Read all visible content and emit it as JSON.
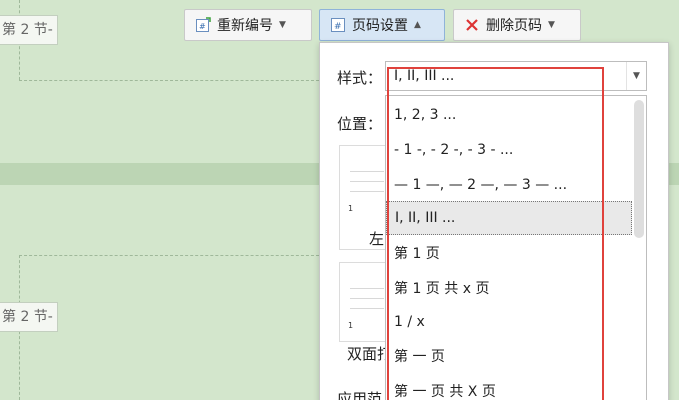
{
  "section_tag": "第 2 节-",
  "toolbar": {
    "renumber": "重新编号",
    "page_settings": "页码设置",
    "delete": "删除页码"
  },
  "panel": {
    "style_label": "样式：",
    "position_label": "位置：",
    "apply_label": "应用范",
    "selected_style": "I, II, III ...",
    "thumb_left_caption": "左",
    "thumb_double_caption": "双面打",
    "thumb_page_number": "1"
  },
  "dropdown": {
    "items": [
      "1, 2, 3 ...",
      "- 1 -, - 2 -, - 3 - ...",
      "— 1 —, — 2 —, — 3 — ...",
      "I, II, III ...",
      "第 1 页",
      "第 1 页 共 x 页",
      "1 / x",
      "第 一 页",
      "第 一 页 共 X 页"
    ],
    "selected_index": 3
  },
  "colors": {
    "background": "#d3e6cc",
    "highlight_box": "#e0423c",
    "active_button": "#d7e6f5"
  }
}
